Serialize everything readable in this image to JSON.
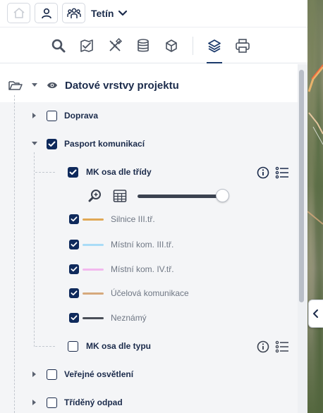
{
  "header": {
    "project_name": "Tetín",
    "buttons": [
      "home-icon",
      "user-icon",
      "users-group-icon"
    ]
  },
  "tools": [
    "search-icon",
    "map-check-icon",
    "measure-icon",
    "database-icon",
    "cube-icon",
    "layers-icon",
    "print-icon"
  ],
  "active_tool": "layers",
  "layers_panel": {
    "root_title": "Datové vrstvy projektu",
    "groups": [
      {
        "label": "Doprava",
        "checked": false,
        "expanded": false
      },
      {
        "label": "Pasport komunikací",
        "checked": true,
        "expanded": true
      },
      {
        "label": "Veřejné osvětlení",
        "checked": false,
        "expanded": false
      },
      {
        "label": "Tříděný odpad",
        "checked": false,
        "expanded": false
      }
    ],
    "sublayers": [
      {
        "label": "MK osa dle třídy",
        "checked": true,
        "opacity_percent": 100,
        "legend": [
          {
            "label": "Silnice III.tř.",
            "color": "#e0a855",
            "checked": true
          },
          {
            "label": "Místní kom. III.tř.",
            "color": "#a9dcf7",
            "checked": true
          },
          {
            "label": "Místní kom. IV.tř.",
            "color": "#f2b8ee",
            "checked": true
          },
          {
            "label": "Účelová komunikace",
            "color": "#d6a97c",
            "checked": true
          },
          {
            "label": "Neznámý",
            "color": "#4a4f58",
            "checked": true
          }
        ]
      },
      {
        "label": "MK osa dle typu",
        "checked": false
      }
    ]
  },
  "colors": {
    "primary": "#0f2a5c",
    "text": "#1b2b4b",
    "muted_text": "#6f7784",
    "panel_bg": "#f4f5f7"
  }
}
